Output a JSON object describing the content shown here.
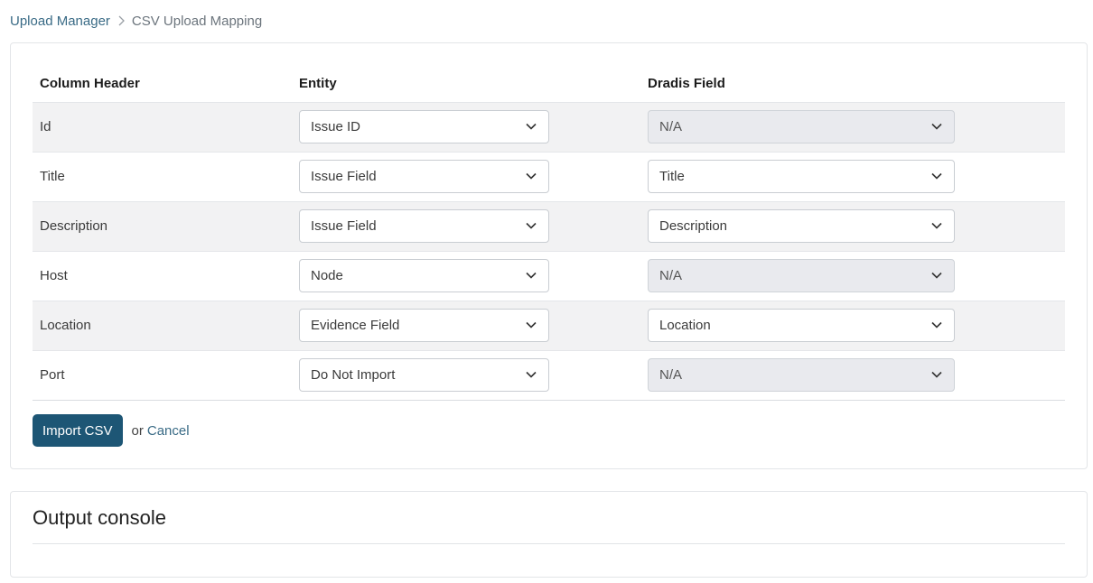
{
  "breadcrumb": {
    "root": "Upload Manager",
    "current": "CSV Upload Mapping"
  },
  "table": {
    "headers": [
      "Column Header",
      "Entity",
      "Dradis Field"
    ],
    "rows": [
      {
        "column": "Id",
        "entity": "Issue ID",
        "field": "N/A",
        "field_disabled": true
      },
      {
        "column": "Title",
        "entity": "Issue Field",
        "field": "Title",
        "field_disabled": false
      },
      {
        "column": "Description",
        "entity": "Issue Field",
        "field": "Description",
        "field_disabled": false
      },
      {
        "column": "Host",
        "entity": "Node",
        "field": "N/A",
        "field_disabled": true
      },
      {
        "column": "Location",
        "entity": "Evidence Field",
        "field": "Location",
        "field_disabled": false
      },
      {
        "column": "Port",
        "entity": "Do Not Import",
        "field": "N/A",
        "field_disabled": true
      }
    ]
  },
  "actions": {
    "import_label": "Import CSV",
    "or_text": "or",
    "cancel_label": "Cancel"
  },
  "console": {
    "title": "Output console"
  },
  "colors": {
    "primary": "#1d5675",
    "link": "#3a6b86",
    "row_stripe": "#f2f2f3",
    "disabled_select": "#e9eaee"
  },
  "icons": {
    "breadcrumb_separator": "chevron-right-icon",
    "select_arrow": "chevron-down-icon"
  }
}
